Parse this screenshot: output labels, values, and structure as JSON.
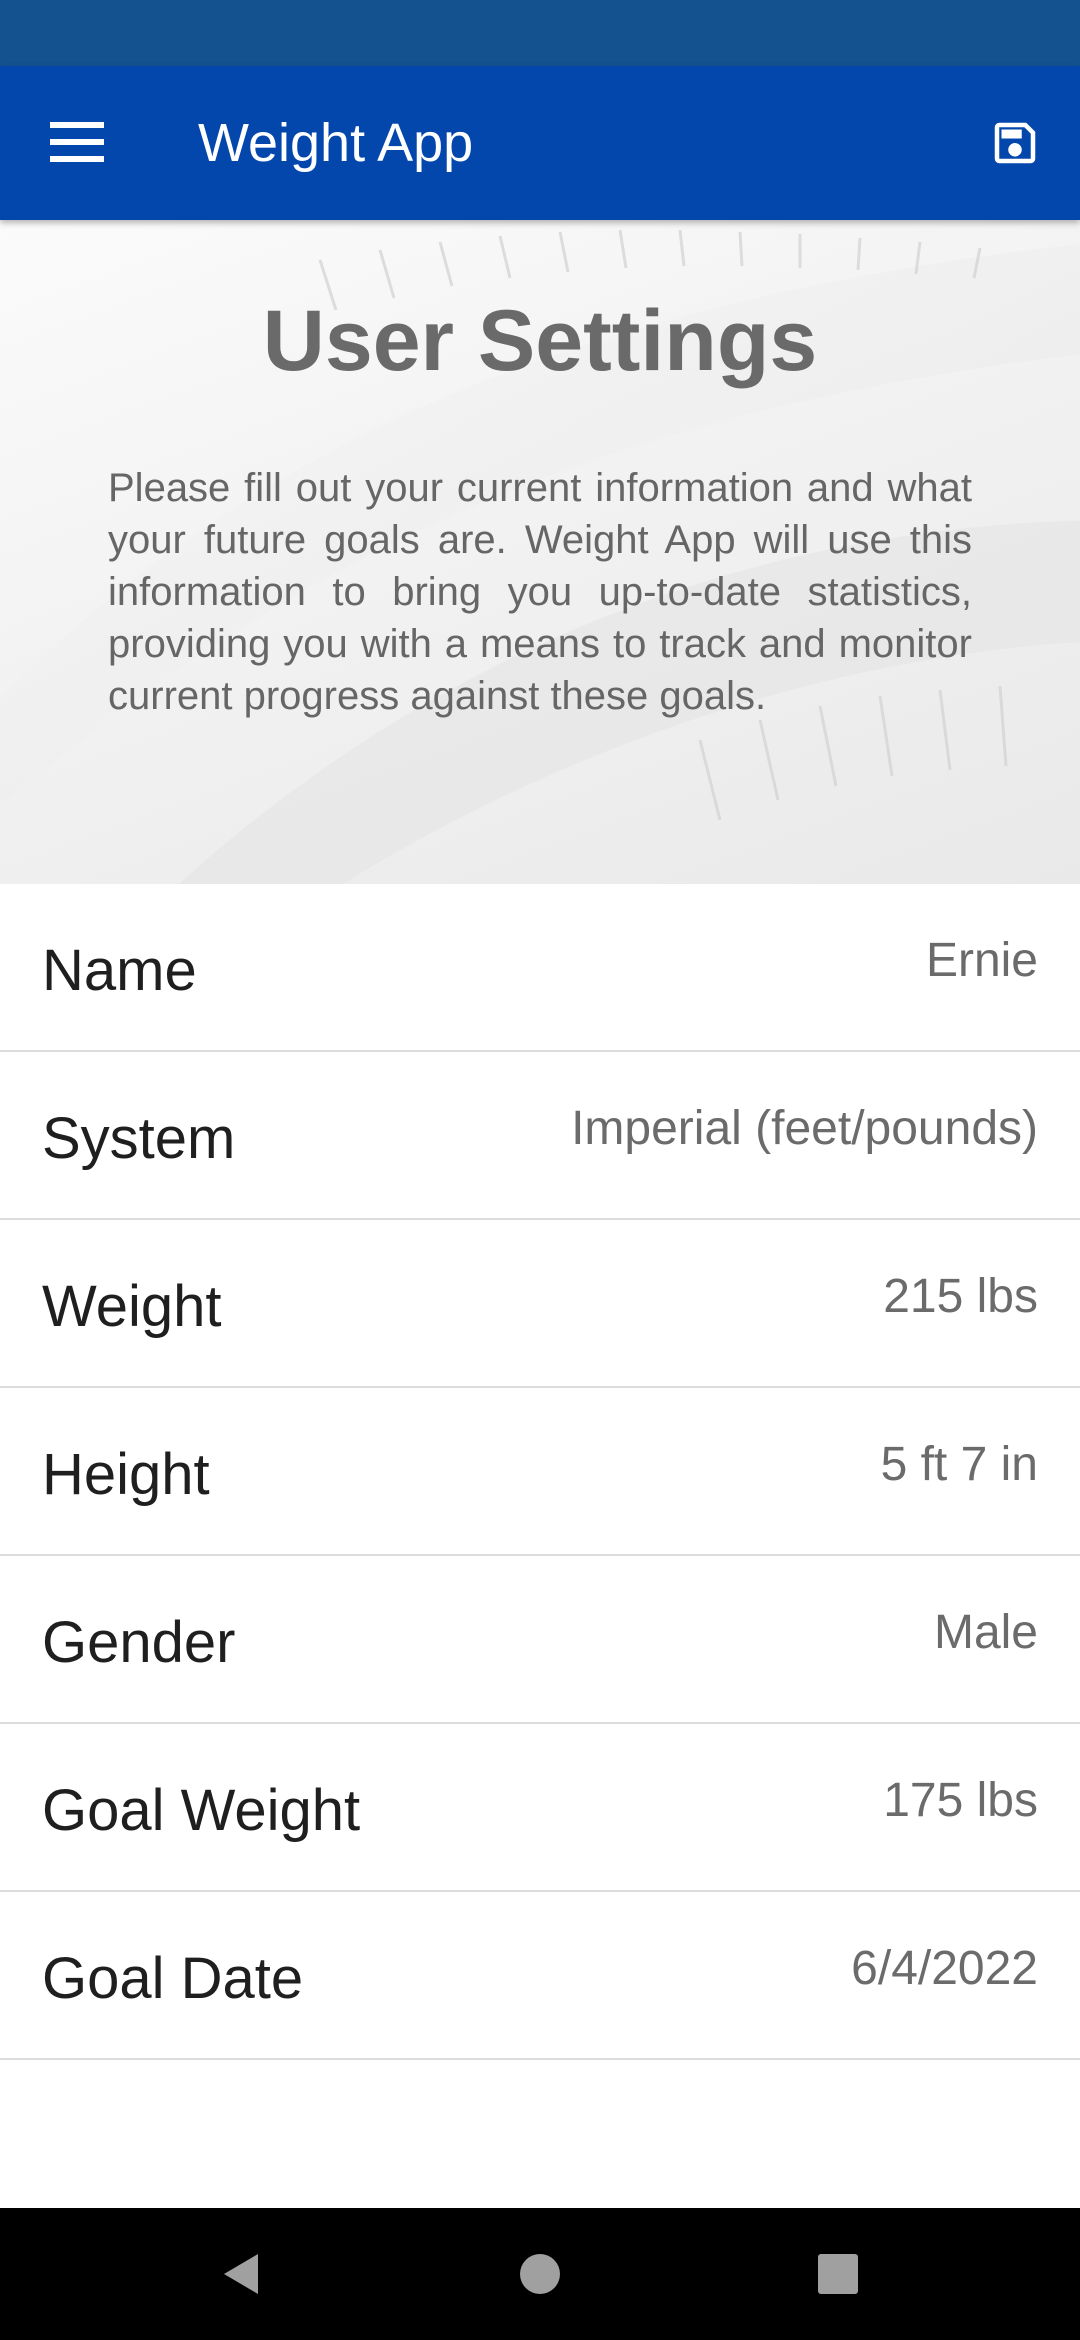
{
  "app": {
    "title": "Weight App",
    "brand_color": "#0347ad",
    "status_bar_color": "#13518f"
  },
  "toolbar": {
    "menu_icon": "hamburger-menu-icon",
    "save_icon": "floppy-save-icon"
  },
  "hero": {
    "title": "User Settings",
    "description": "Please fill out your current information and what your future goals are. Weight App will use this information to bring you up-to-date statistics, providing you with a means to track and monitor current progress against these goals."
  },
  "settings": [
    {
      "label": "Name",
      "value": "Ernie"
    },
    {
      "label": "System",
      "value": "Imperial (feet/pounds)"
    },
    {
      "label": "Weight",
      "value": "215 lbs"
    },
    {
      "label": "Height",
      "value": "5 ft 7 in"
    },
    {
      "label": "Gender",
      "value": "Male"
    },
    {
      "label": "Goal Weight",
      "value": "175 lbs"
    },
    {
      "label": "Goal Date",
      "value": "6/4/2022"
    }
  ],
  "nav_bar": {
    "back_icon": "back-triangle-icon",
    "home_icon": "home-circle-icon",
    "recents_icon": "recents-square-icon"
  }
}
